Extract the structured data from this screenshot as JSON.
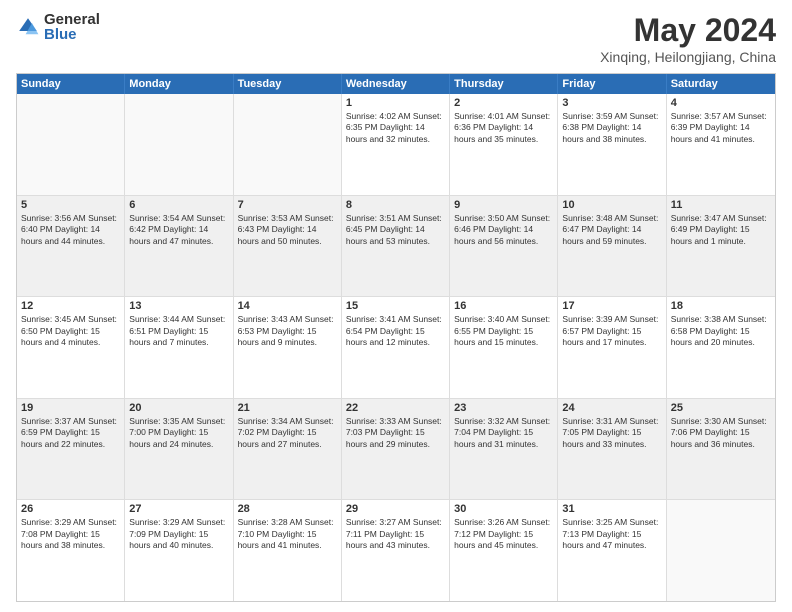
{
  "logo": {
    "general": "General",
    "blue": "Blue"
  },
  "title": {
    "month": "May 2024",
    "location": "Xinqing, Heilongjiang, China"
  },
  "header": {
    "days": [
      "Sunday",
      "Monday",
      "Tuesday",
      "Wednesday",
      "Thursday",
      "Friday",
      "Saturday"
    ]
  },
  "rows": [
    [
      {
        "day": "",
        "text": "",
        "empty": true
      },
      {
        "day": "",
        "text": "",
        "empty": true
      },
      {
        "day": "",
        "text": "",
        "empty": true
      },
      {
        "day": "1",
        "text": "Sunrise: 4:02 AM\nSunset: 6:35 PM\nDaylight: 14 hours\nand 32 minutes.",
        "empty": false
      },
      {
        "day": "2",
        "text": "Sunrise: 4:01 AM\nSunset: 6:36 PM\nDaylight: 14 hours\nand 35 minutes.",
        "empty": false
      },
      {
        "day": "3",
        "text": "Sunrise: 3:59 AM\nSunset: 6:38 PM\nDaylight: 14 hours\nand 38 minutes.",
        "empty": false
      },
      {
        "day": "4",
        "text": "Sunrise: 3:57 AM\nSunset: 6:39 PM\nDaylight: 14 hours\nand 41 minutes.",
        "empty": false
      }
    ],
    [
      {
        "day": "5",
        "text": "Sunrise: 3:56 AM\nSunset: 6:40 PM\nDaylight: 14 hours\nand 44 minutes.",
        "empty": false
      },
      {
        "day": "6",
        "text": "Sunrise: 3:54 AM\nSunset: 6:42 PM\nDaylight: 14 hours\nand 47 minutes.",
        "empty": false
      },
      {
        "day": "7",
        "text": "Sunrise: 3:53 AM\nSunset: 6:43 PM\nDaylight: 14 hours\nand 50 minutes.",
        "empty": false
      },
      {
        "day": "8",
        "text": "Sunrise: 3:51 AM\nSunset: 6:45 PM\nDaylight: 14 hours\nand 53 minutes.",
        "empty": false
      },
      {
        "day": "9",
        "text": "Sunrise: 3:50 AM\nSunset: 6:46 PM\nDaylight: 14 hours\nand 56 minutes.",
        "empty": false
      },
      {
        "day": "10",
        "text": "Sunrise: 3:48 AM\nSunset: 6:47 PM\nDaylight: 14 hours\nand 59 minutes.",
        "empty": false
      },
      {
        "day": "11",
        "text": "Sunrise: 3:47 AM\nSunset: 6:49 PM\nDaylight: 15 hours\nand 1 minute.",
        "empty": false
      }
    ],
    [
      {
        "day": "12",
        "text": "Sunrise: 3:45 AM\nSunset: 6:50 PM\nDaylight: 15 hours\nand 4 minutes.",
        "empty": false
      },
      {
        "day": "13",
        "text": "Sunrise: 3:44 AM\nSunset: 6:51 PM\nDaylight: 15 hours\nand 7 minutes.",
        "empty": false
      },
      {
        "day": "14",
        "text": "Sunrise: 3:43 AM\nSunset: 6:53 PM\nDaylight: 15 hours\nand 9 minutes.",
        "empty": false
      },
      {
        "day": "15",
        "text": "Sunrise: 3:41 AM\nSunset: 6:54 PM\nDaylight: 15 hours\nand 12 minutes.",
        "empty": false
      },
      {
        "day": "16",
        "text": "Sunrise: 3:40 AM\nSunset: 6:55 PM\nDaylight: 15 hours\nand 15 minutes.",
        "empty": false
      },
      {
        "day": "17",
        "text": "Sunrise: 3:39 AM\nSunset: 6:57 PM\nDaylight: 15 hours\nand 17 minutes.",
        "empty": false
      },
      {
        "day": "18",
        "text": "Sunrise: 3:38 AM\nSunset: 6:58 PM\nDaylight: 15 hours\nand 20 minutes.",
        "empty": false
      }
    ],
    [
      {
        "day": "19",
        "text": "Sunrise: 3:37 AM\nSunset: 6:59 PM\nDaylight: 15 hours\nand 22 minutes.",
        "empty": false
      },
      {
        "day": "20",
        "text": "Sunrise: 3:35 AM\nSunset: 7:00 PM\nDaylight: 15 hours\nand 24 minutes.",
        "empty": false
      },
      {
        "day": "21",
        "text": "Sunrise: 3:34 AM\nSunset: 7:02 PM\nDaylight: 15 hours\nand 27 minutes.",
        "empty": false
      },
      {
        "day": "22",
        "text": "Sunrise: 3:33 AM\nSunset: 7:03 PM\nDaylight: 15 hours\nand 29 minutes.",
        "empty": false
      },
      {
        "day": "23",
        "text": "Sunrise: 3:32 AM\nSunset: 7:04 PM\nDaylight: 15 hours\nand 31 minutes.",
        "empty": false
      },
      {
        "day": "24",
        "text": "Sunrise: 3:31 AM\nSunset: 7:05 PM\nDaylight: 15 hours\nand 33 minutes.",
        "empty": false
      },
      {
        "day": "25",
        "text": "Sunrise: 3:30 AM\nSunset: 7:06 PM\nDaylight: 15 hours\nand 36 minutes.",
        "empty": false
      }
    ],
    [
      {
        "day": "26",
        "text": "Sunrise: 3:29 AM\nSunset: 7:08 PM\nDaylight: 15 hours\nand 38 minutes.",
        "empty": false
      },
      {
        "day": "27",
        "text": "Sunrise: 3:29 AM\nSunset: 7:09 PM\nDaylight: 15 hours\nand 40 minutes.",
        "empty": false
      },
      {
        "day": "28",
        "text": "Sunrise: 3:28 AM\nSunset: 7:10 PM\nDaylight: 15 hours\nand 41 minutes.",
        "empty": false
      },
      {
        "day": "29",
        "text": "Sunrise: 3:27 AM\nSunset: 7:11 PM\nDaylight: 15 hours\nand 43 minutes.",
        "empty": false
      },
      {
        "day": "30",
        "text": "Sunrise: 3:26 AM\nSunset: 7:12 PM\nDaylight: 15 hours\nand 45 minutes.",
        "empty": false
      },
      {
        "day": "31",
        "text": "Sunrise: 3:25 AM\nSunset: 7:13 PM\nDaylight: 15 hours\nand 47 minutes.",
        "empty": false
      },
      {
        "day": "",
        "text": "",
        "empty": true
      }
    ]
  ]
}
